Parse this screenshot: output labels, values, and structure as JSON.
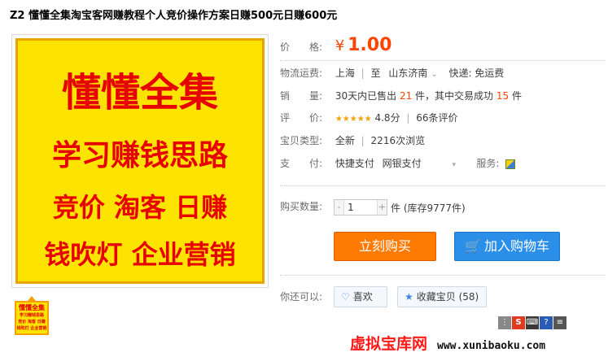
{
  "title": "Z2 懂懂全集淘宝客网赚教程个人竞价操作方案日赚500元日赚600元",
  "product_image": {
    "line1": "懂懂全集",
    "line2": "学习赚钱思路",
    "line3": "竞价 淘客 日赚",
    "line4": "钱吹灯  企业营销"
  },
  "thumbnail": {
    "line1": "懂懂全集",
    "line2": "学习赚钱思路",
    "line3": "竞价 淘客 日赚",
    "line4": "钱吹灯 企业营销"
  },
  "price": {
    "label": "价　　格:",
    "currency": "¥",
    "value": "1.00"
  },
  "shipping": {
    "label": "物流运费:",
    "from": "上海",
    "sep": "|",
    "to_prefix": "至",
    "to": "山东济南",
    "arrow": "⌄",
    "method": "快递: 免运费"
  },
  "sales": {
    "label": "销　　量:",
    "prefix": "30天内已售出",
    "count": "21",
    "mid": "件，其中交易成功",
    "success": "15",
    "suffix": "件"
  },
  "rating": {
    "label": "评　　价:",
    "stars": "★★★★★",
    "score": "4.8分",
    "sep": "|",
    "reviews": "66条评价"
  },
  "type": {
    "label": "宝贝类型:",
    "value": "全新",
    "sep": "|",
    "views": "2216次浏览"
  },
  "payment": {
    "label": "支　　付:",
    "method1": "快捷支付",
    "method2": "网银支付",
    "service_label": "服务:"
  },
  "quantity": {
    "label": "购买数量:",
    "minus": "-",
    "value": "1",
    "plus": "+",
    "stock": "件 (库存9777件)"
  },
  "buttons": {
    "buy": "立刻购买",
    "cart": "加入购物车"
  },
  "also": {
    "label": "你还可以:",
    "like": "喜欢",
    "fav": "收藏宝贝 (58)"
  },
  "watermark": {
    "cn": "虚拟宝库网",
    "en": "www.xunibaoku.com"
  },
  "colors": {
    "accent": "#ff4400",
    "buy_button": "#ff7a00",
    "cart_button": "#2b8fea",
    "poster_bg": "#fce300",
    "poster_text": "#e60000"
  }
}
